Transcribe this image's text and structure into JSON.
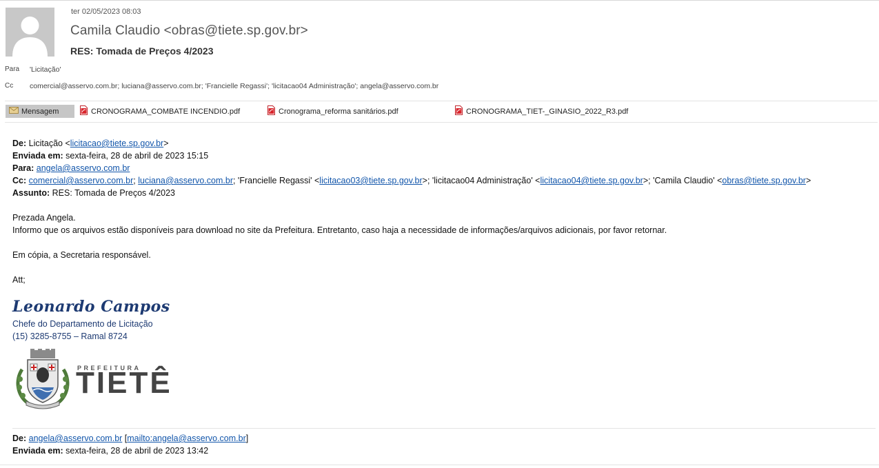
{
  "header": {
    "date": "ter 02/05/2023 08:03",
    "sender": "Camila Claudio <obras@tiete.sp.gov.br>",
    "subject": "RES: Tomada de Preços 4/2023",
    "to_label": "Para",
    "to_value": "'Licitação'",
    "cc_label": "Cc",
    "cc_value": "comercial@asservo.com.br; luciana@asservo.com.br; 'Francielle Regassi'; 'licitacao04 Administração'; angela@asservo.com.br"
  },
  "tabs": {
    "message_label": "Mensagem",
    "attachments": [
      "CRONOGRAMA_COMBATE INCENDIO.pdf",
      "Cronograma_reforma sanitários.pdf",
      "CRONOGRAMA_TIET-_GINASIO_2022_R3.pdf"
    ]
  },
  "quoted": {
    "from_label": "De:",
    "from_name": "Licitação <",
    "from_email": "licitacao@tiete.sp.gov.br",
    "from_close": ">",
    "sent_label": "Enviada em:",
    "sent_value": "sexta-feira, 28 de abril de 2023 15:15",
    "to_label": "Para:",
    "to_email": "angela@asservo.com.br",
    "cc_label": "Cc:",
    "cc_email1": "comercial@asservo.com.br",
    "cc_sep1": ";",
    "cc_email2": "luciana@asservo.com.br",
    "cc_text1": "; 'Francielle Regassi' <",
    "cc_email3": "licitacao03@tiete.sp.gov.br",
    "cc_text2": ">; 'licitacao04 Administração' <",
    "cc_email4": "licitacao04@tiete.sp.gov.br",
    "cc_text3": ">; 'Camila Claudio' <",
    "cc_email5": "obras@tiete.sp.gov.br",
    "cc_text4": ">",
    "subject_label": "Assunto:",
    "subject_value": "RES: Tomada de Preços 4/2023"
  },
  "message": {
    "greeting": "Prezada Angela.",
    "line1": "Informo que os arquivos estão disponíveis para download no site da Prefeitura. Entretanto, caso haja a necessidade de informações/arquivos adicionais, por favor retornar.",
    "line2": "Em cópia, a Secretaria responsável.",
    "closing": "Att;"
  },
  "signature": {
    "name": "Leonardo Campos",
    "title": "Chefe do Departamento de Licitação",
    "phone": "(15) 3285-8755 – Ramal 8724",
    "logo_small": "PREFEITURA",
    "logo_big": "TIETÊ"
  },
  "quoted2": {
    "from_label": "De:",
    "from_email": "angela@asservo.com.br",
    "from_mailto_open": " [",
    "from_mailto": "mailto:angela@asservo.com.br",
    "from_mailto_close": "]",
    "sent_label": "Enviada em:",
    "sent_value": "sexta-feira, 28 de abril de 2023 13:42"
  },
  "colors": {
    "link": "#1155aa",
    "signature": "#1d3a72",
    "tab_bg": "#c6c6c6"
  }
}
